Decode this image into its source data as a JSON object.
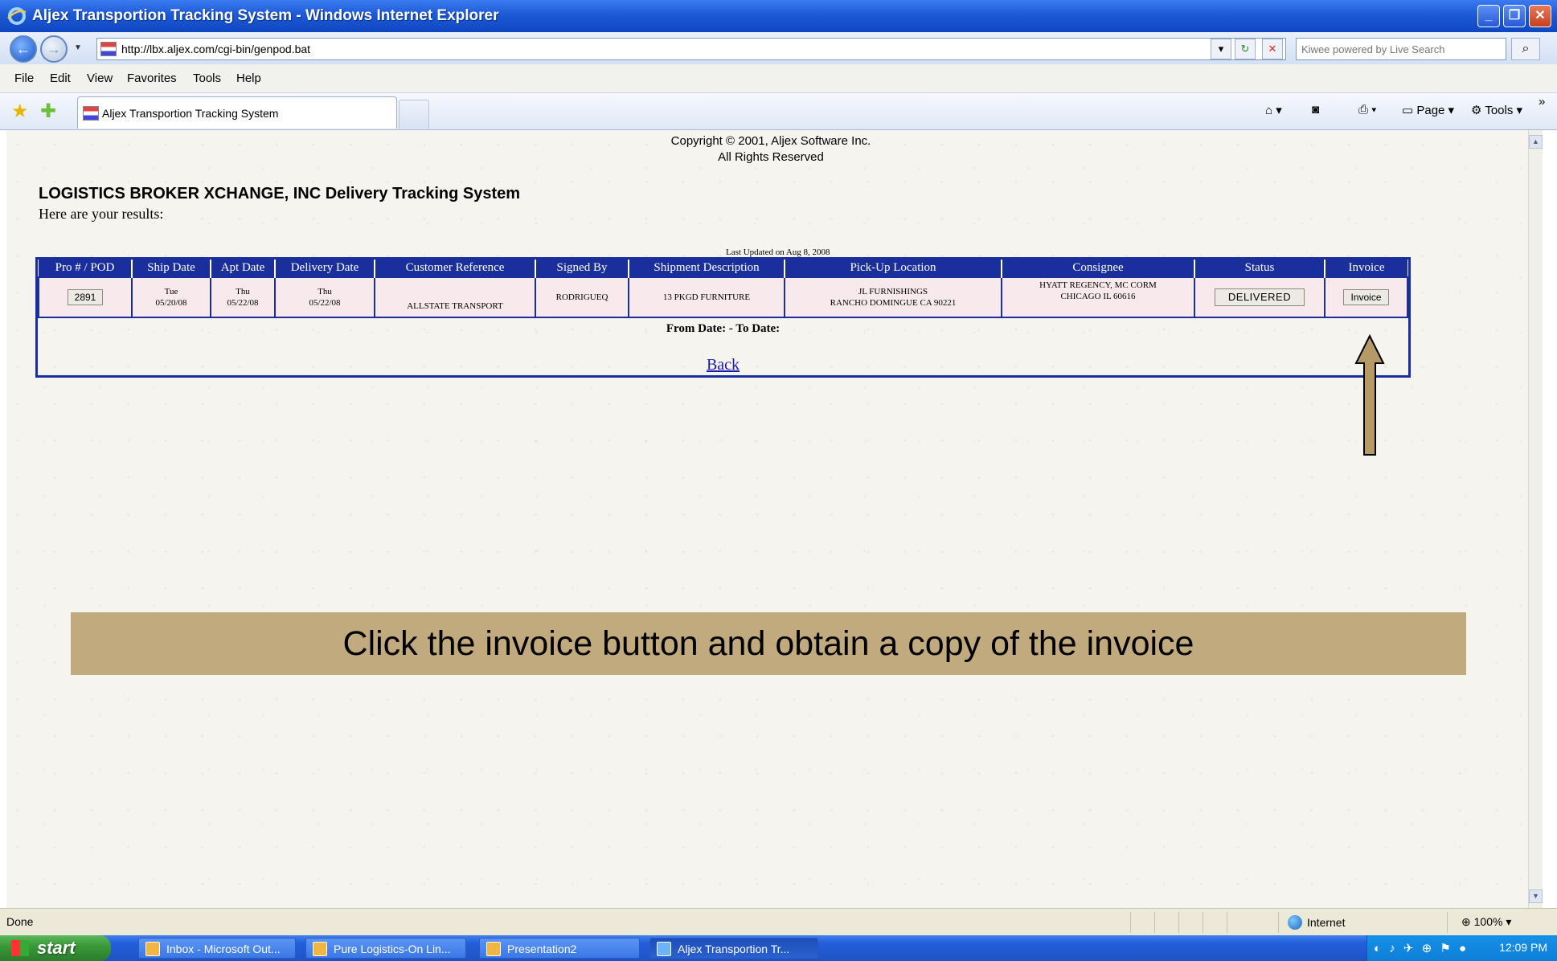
{
  "window": {
    "title": "Aljex Transportion Tracking System - Windows Internet Explorer"
  },
  "address": {
    "url": "http://lbx.aljex.com/cgi-bin/genpod.bat",
    "search_placeholder": "Kiwee powered by Live Search"
  },
  "menu": [
    "File",
    "Edit",
    "View",
    "Favorites",
    "Tools",
    "Help"
  ],
  "tab": {
    "label": "Aljex Transportion Tracking System"
  },
  "command_bar": {
    "page": "Page",
    "tools": "Tools"
  },
  "page": {
    "copyright_line1": "Copyright © 2001, Aljex Software Inc.",
    "copyright_line2": "All Rights Reserved",
    "title": "LOGISTICS BROKER XCHANGE, INC Delivery Tracking System",
    "results_label": "Here are your results:",
    "last_updated": "Last Updated on Aug 8, 2008",
    "columns": [
      "Pro # / POD",
      "Ship Date",
      "Apt Date",
      "Delivery Date",
      "Customer Reference",
      "Signed By",
      "Shipment Description",
      "Pick-Up Location",
      "Consignee",
      "Status",
      "Invoice"
    ],
    "row": {
      "pro": "2891",
      "ship_day": "Tue",
      "ship_date": "05/20/08",
      "apt_day": "Thu",
      "apt_date": "05/22/08",
      "delivery_day": "Thu",
      "delivery_date": "05/22/08",
      "customer_reference": "ALLSTATE TRANSPORT",
      "signed_by": "RODRIGUEQ",
      "shipment_description": "13 PKGD FURNITURE",
      "pickup_line1": "JL FURNISHINGS",
      "pickup_line2": "RANCHO DOMINGUE  CA  90221",
      "consignee_line1": "HYATT REGENCY, MC CORM",
      "consignee_line2": "CHICAGO  IL  60616",
      "status": "DELIVERED",
      "invoice": "Invoice"
    },
    "from_to": "From Date: - To Date:",
    "back": "Back"
  },
  "callout": "Click the invoice button and obtain a copy of the invoice",
  "statusbar": {
    "left": "Done",
    "zone": "Internet",
    "zoom": "100%"
  },
  "taskbar": {
    "start": "start",
    "items": [
      "Inbox - Microsoft Out...",
      "Pure Logistics-On Lin...",
      "Presentation2",
      "Aljex Transportion Tr..."
    ],
    "clock": "12:09 PM"
  },
  "colors": {
    "table_header": "#1a2f9c",
    "row_bg": "#f7e9ec",
    "callout_bg": "#c1aa7e",
    "title_bar": "#1d5ad6"
  }
}
